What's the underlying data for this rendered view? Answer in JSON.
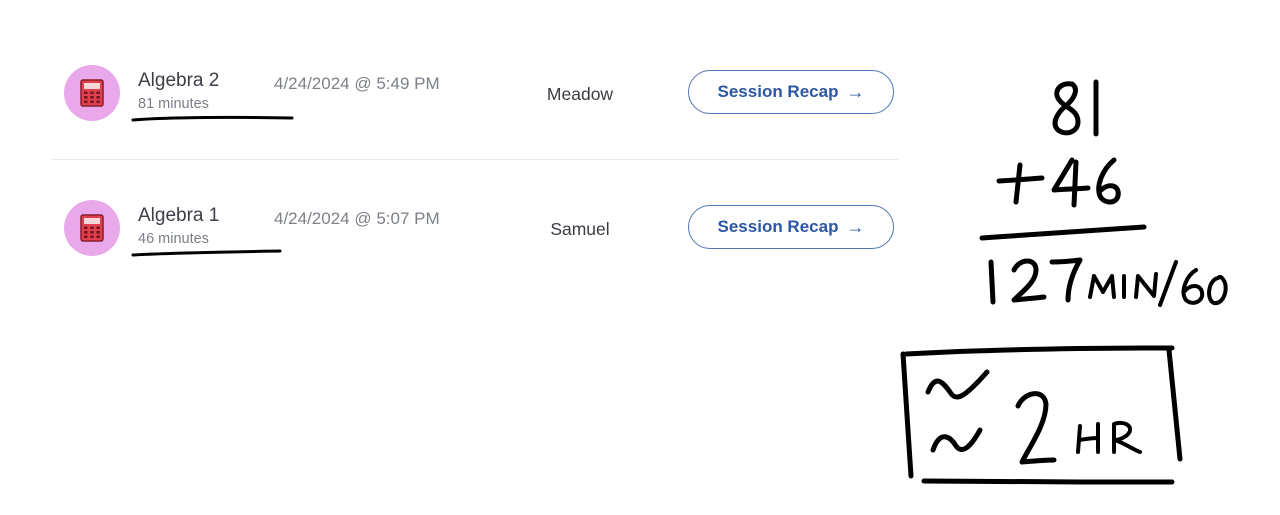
{
  "sessions": [
    {
      "subject": "Algebra 2",
      "duration": "81 minutes",
      "datetime": "4/24/2024 @ 5:49 PM",
      "tutor": "Meadow",
      "recap_label": "Session Recap",
      "recap_arrow": "→",
      "icon": "calculator-icon"
    },
    {
      "subject": "Algebra 1",
      "duration": "46 minutes",
      "datetime": "4/24/2024 @ 5:07 PM",
      "tutor": "Samuel",
      "recap_label": "Session Recap",
      "recap_arrow": "→",
      "icon": "calculator-icon"
    }
  ],
  "annotation": {
    "line1": "81",
    "line2": "+46",
    "line3": "127 MIN/60",
    "result": "≈ 2 HR"
  },
  "colors": {
    "avatar_bg": "#e9a8ea",
    "button_accent": "#2c57a4",
    "ink": "#000000"
  }
}
